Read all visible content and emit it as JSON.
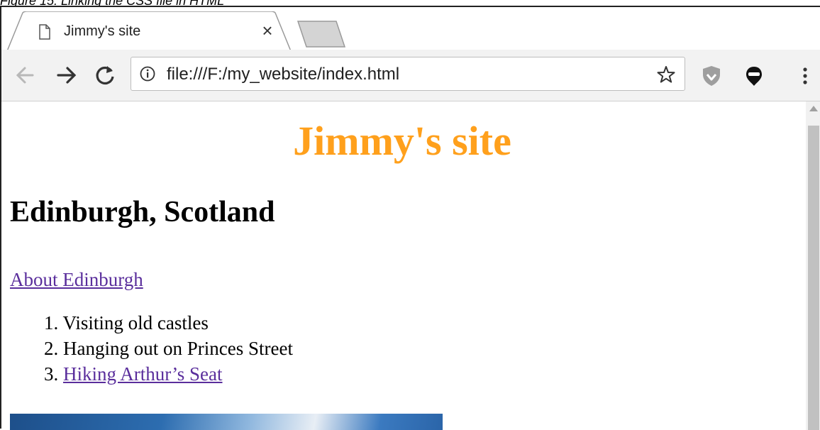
{
  "caption": "Figure 15: Linking the CSS file in HTML",
  "browser": {
    "tab": {
      "title": "Jimmy's site",
      "close_glyph": "×",
      "icon": "page-icon"
    },
    "url": "file:///F:/my_website/index.html",
    "nav": {
      "back_glyph": "←",
      "forward_glyph": "→",
      "reload_glyph": "C"
    },
    "menu_glyph": "⋮"
  },
  "page": {
    "title": "Jimmy's site",
    "heading": "Edinburgh, Scotland",
    "about_link": "About Edinburgh",
    "list": [
      {
        "num": "1.",
        "text": "Visiting old castles"
      },
      {
        "num": "2.",
        "text": "Hanging out on Princes Street"
      },
      {
        "num": "3.",
        "text": "Hiking Arthur’s Seat"
      }
    ]
  },
  "colors": {
    "title": "#ffa01c",
    "link": "#5a2e9c"
  }
}
